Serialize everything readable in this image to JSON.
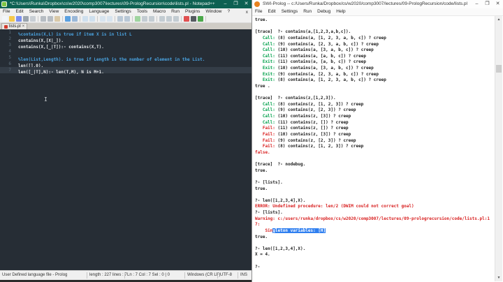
{
  "notepadpp": {
    "title": "*C:\\Users\\Runka\\Dropbox\\cs\\w2020\\comp3007\\lectures\\09-PrologRecursion\\code\\lists.pl - Notepad++",
    "window_buttons": {
      "minimize": "–",
      "maximize": "❐",
      "close": "✕"
    },
    "menus": [
      "File",
      "Edit",
      "Search",
      "View",
      "Encoding",
      "Language",
      "Settings",
      "Tools",
      "Macro",
      "Run",
      "Plugins",
      "Window",
      "?"
    ],
    "menubar_close": "x",
    "toolbar_icons": [
      {
        "name": "new-file",
        "color": "#f2f6fa"
      },
      {
        "name": "open-folder",
        "color": "#f5c94a"
      },
      {
        "name": "save",
        "color": "#7a8ef0"
      },
      {
        "name": "save-all",
        "color": "#9aa4ad"
      },
      {
        "name": "print",
        "color": "#c8ced4"
      },
      {
        "name": "cut",
        "color": "#b7bdc3"
      },
      {
        "name": "copy",
        "color": "#b7bdc3"
      },
      {
        "name": "paste",
        "color": "#d9c9a8"
      },
      {
        "name": "undo",
        "color": "#5aa0e0"
      },
      {
        "name": "redo",
        "color": "#9ab8d8"
      },
      {
        "name": "find",
        "color": "#cfe0ee"
      },
      {
        "name": "replace",
        "color": "#cfe0ee"
      },
      {
        "name": "zoom-in",
        "color": "#d7e4ef"
      },
      {
        "name": "zoom-out",
        "color": "#d7e4ef"
      },
      {
        "name": "sync-vertical",
        "color": "#b9c8d6"
      },
      {
        "name": "sync-horizontal",
        "color": "#b9c8d6"
      },
      {
        "name": "word-wrap",
        "color": "#9fd49f"
      },
      {
        "name": "show-all-chars",
        "color": "#c3ccd2"
      },
      {
        "name": "indent-guide",
        "color": "#c3ccd2"
      },
      {
        "name": "function-list",
        "color": "#c3ccd2"
      },
      {
        "name": "document-map",
        "color": "#c3ccd2"
      },
      {
        "name": "document-list",
        "color": "#c3ccd2"
      },
      {
        "name": "record-macro",
        "color": "#e05050"
      },
      {
        "name": "stop-macro",
        "color": "#555b60"
      },
      {
        "name": "play-macro",
        "color": "#4aa84a"
      }
    ],
    "tab": {
      "label": "lists.pl",
      "close": "×"
    },
    "editor_lines": [
      {
        "num": "1",
        "kind": "comment",
        "text": "%contains(X,L) is true if item X is in list L",
        "current": false
      },
      {
        "num": "2",
        "kind": "code",
        "text": "contains(X,[X|_]).",
        "current": false
      },
      {
        "num": "3",
        "kind": "code",
        "text": "contains(X,[_|T]):- contains(X,T).",
        "current": false
      },
      {
        "num": "4",
        "kind": "code",
        "text": "",
        "current": false
      },
      {
        "num": "5",
        "kind": "comment",
        "text": "%len(List,Length). is true if Length is the number of element in the List.",
        "current": false
      },
      {
        "num": "6",
        "kind": "code",
        "text": "len([],0).",
        "current": false
      },
      {
        "num": "7",
        "kind": "code",
        "text": "len([_|T],N):- len(T,M), N is M+1.",
        "current": true
      }
    ],
    "statusbar": {
      "doc_type": "User Defined language file - Prolog",
      "length_lines": "length : 227    lines : 7",
      "position": "Ln : 7    Col : 7    Sel : 0 | 0",
      "eol": "Windows (CR LF)",
      "encoding": "UTF-8",
      "mode": "INS"
    }
  },
  "swiprolog": {
    "title": "SWI-Prolog -- c:/Users/Runka/Dropbox/cs/w2020/comp3007/lectures/09-PrologRecursion/code/lists.pl",
    "window_buttons": {
      "minimize": "–",
      "maximize": "❐",
      "close": "✕"
    },
    "menus": [
      "File",
      "Edit",
      "Settings",
      "Run",
      "Debug",
      "Help"
    ],
    "colors": {
      "call_exit_green": "#00a04a",
      "fail_error_red": "#d81e1e",
      "selection_blue": "#2f7ff0"
    },
    "console_lines": [
      [
        [
          "b",
          "true."
        ]
      ],
      [],
      [
        [
          "p",
          "[trace]  ?- "
        ],
        [
          "b",
          "contains(a,[1,2,3,a,b,c])."
        ]
      ],
      [
        [
          "g",
          "   Call:"
        ],
        [
          "p",
          " (8) contains(a, [1, 2, 3, a, b, c]) ? creep"
        ]
      ],
      [
        [
          "g",
          "   Call:"
        ],
        [
          "p",
          " (9) contains(a, [2, 3, a, b, c]) ? creep"
        ]
      ],
      [
        [
          "g",
          "   Call:"
        ],
        [
          "p",
          " (10) contains(a, [3, a, b, c]) ? creep"
        ]
      ],
      [
        [
          "g",
          "   Call:"
        ],
        [
          "p",
          " (11) contains(a, [a, b, c]) ? creep"
        ]
      ],
      [
        [
          "g",
          "   Exit:"
        ],
        [
          "p",
          " (11) contains(a, [a, b, c]) ? creep"
        ]
      ],
      [
        [
          "g",
          "   Exit:"
        ],
        [
          "p",
          " (10) contains(a, [3, a, b, c]) ? creep"
        ]
      ],
      [
        [
          "g",
          "   Exit:"
        ],
        [
          "p",
          " (9) contains(a, [2, 3, a, b, c]) ? creep"
        ]
      ],
      [
        [
          "g",
          "   Exit:"
        ],
        [
          "p",
          " (8) contains(a, [1, 2, 3, a, b, c]) ? creep"
        ]
      ],
      [
        [
          "b",
          "true ."
        ]
      ],
      [],
      [
        [
          "p",
          "[trace]  ?- "
        ],
        [
          "b",
          "contains(z,[1,2,3])."
        ]
      ],
      [
        [
          "g",
          "   Call:"
        ],
        [
          "p",
          " (8) contains(z, [1, 2, 3]) ? creep"
        ]
      ],
      [
        [
          "g",
          "   Call:"
        ],
        [
          "p",
          " (9) contains(z, [2, 3]) ? creep"
        ]
      ],
      [
        [
          "g",
          "   Call:"
        ],
        [
          "p",
          " (10) contains(z, [3]) ? creep"
        ]
      ],
      [
        [
          "g",
          "   Call:"
        ],
        [
          "p",
          " (11) contains(z, []) ? creep"
        ]
      ],
      [
        [
          "rb",
          "   Fail:"
        ],
        [
          "p",
          " (11) contains(z, []) ? creep"
        ]
      ],
      [
        [
          "rb",
          "   Fail:"
        ],
        [
          "p",
          " (10) contains(z, [3]) ? creep"
        ]
      ],
      [
        [
          "rb",
          "   Fail:"
        ],
        [
          "p",
          " (9) contains(z, [2, 3]) ? creep"
        ]
      ],
      [
        [
          "rb",
          "   Fail:"
        ],
        [
          "p",
          " (8) contains(z, [1, 2, 3]) ? creep"
        ]
      ],
      [
        [
          "rb",
          "false."
        ]
      ],
      [],
      [
        [
          "p",
          "[trace]  ?- "
        ],
        [
          "b",
          "nodebug."
        ]
      ],
      [
        [
          "b",
          "true."
        ]
      ],
      [],
      [
        [
          "p",
          "?- "
        ],
        [
          "b",
          "[lists]."
        ]
      ],
      [
        [
          "b",
          "true."
        ]
      ],
      [],
      [
        [
          "p",
          "?- "
        ],
        [
          "b",
          "len([1,2,3,4],X)."
        ]
      ],
      [
        [
          "rb",
          "ERROR: Undefined procedure: len/2 (DWIM could not correct goal)"
        ]
      ],
      [
        [
          "p",
          "?- "
        ],
        [
          "b",
          "[lists]."
        ]
      ],
      [
        [
          "r",
          "Warning: c:/users/runka/dropbox/cs/w2020/comp3007/lectures/09-prologrecursion/code/lists.pl:1"
        ]
      ],
      [
        [
          "r",
          "7:"
        ]
      ],
      [
        [
          "r",
          "    Sin"
        ],
        [
          "sel",
          "gleton variables: [H]"
        ]
      ],
      [
        [
          "b",
          "true."
        ]
      ],
      [],
      [
        [
          "p",
          "?- "
        ],
        [
          "b",
          "len([1,2,3,4],X)."
        ]
      ],
      [
        [
          "b",
          "X = 4."
        ]
      ],
      [],
      [
        [
          "p",
          "?- "
        ]
      ]
    ]
  }
}
